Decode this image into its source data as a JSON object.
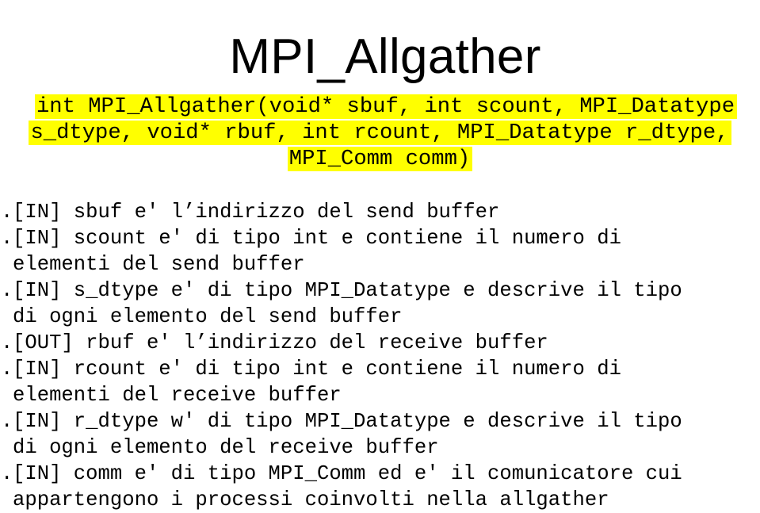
{
  "title": "MPI_Allgather",
  "signature": {
    "lines": [
      "int MPI_Allgather(void* sbuf, int scount, MPI_Datatype",
      "s_dtype, void* rbuf, int rcount, MPI_Datatype r_dtype,",
      "MPI_Comm comm)"
    ],
    "highlight_color": "#ffff00"
  },
  "bullet_glyph": ".",
  "params": [
    {
      "lines": [
        "[IN] sbuf e' l’indirizzo del send buffer"
      ]
    },
    {
      "lines": [
        "[IN] scount e' di tipo int e contiene il numero di",
        "elementi del send buffer"
      ]
    },
    {
      "lines": [
        "[IN] s_dtype e' di tipo MPI_Datatype e descrive il tipo",
        "di ogni elemento del send buffer"
      ]
    },
    {
      "lines": [
        "[OUT] rbuf e' l’indirizzo del receive buffer"
      ]
    },
    {
      "lines": [
        "[IN] rcount e' di tipo int e contiene il numero di",
        "elementi del receive buffer"
      ]
    },
    {
      "lines": [
        "[IN] r_dtype w' di tipo MPI_Datatype e descrive il tipo",
        "di ogni elemento del receive buffer"
      ]
    },
    {
      "lines": [
        "[IN] comm e' di tipo MPI_Comm ed e' il comunicatore cui",
        "appartengono i processi coinvolti nella allgather"
      ]
    }
  ]
}
